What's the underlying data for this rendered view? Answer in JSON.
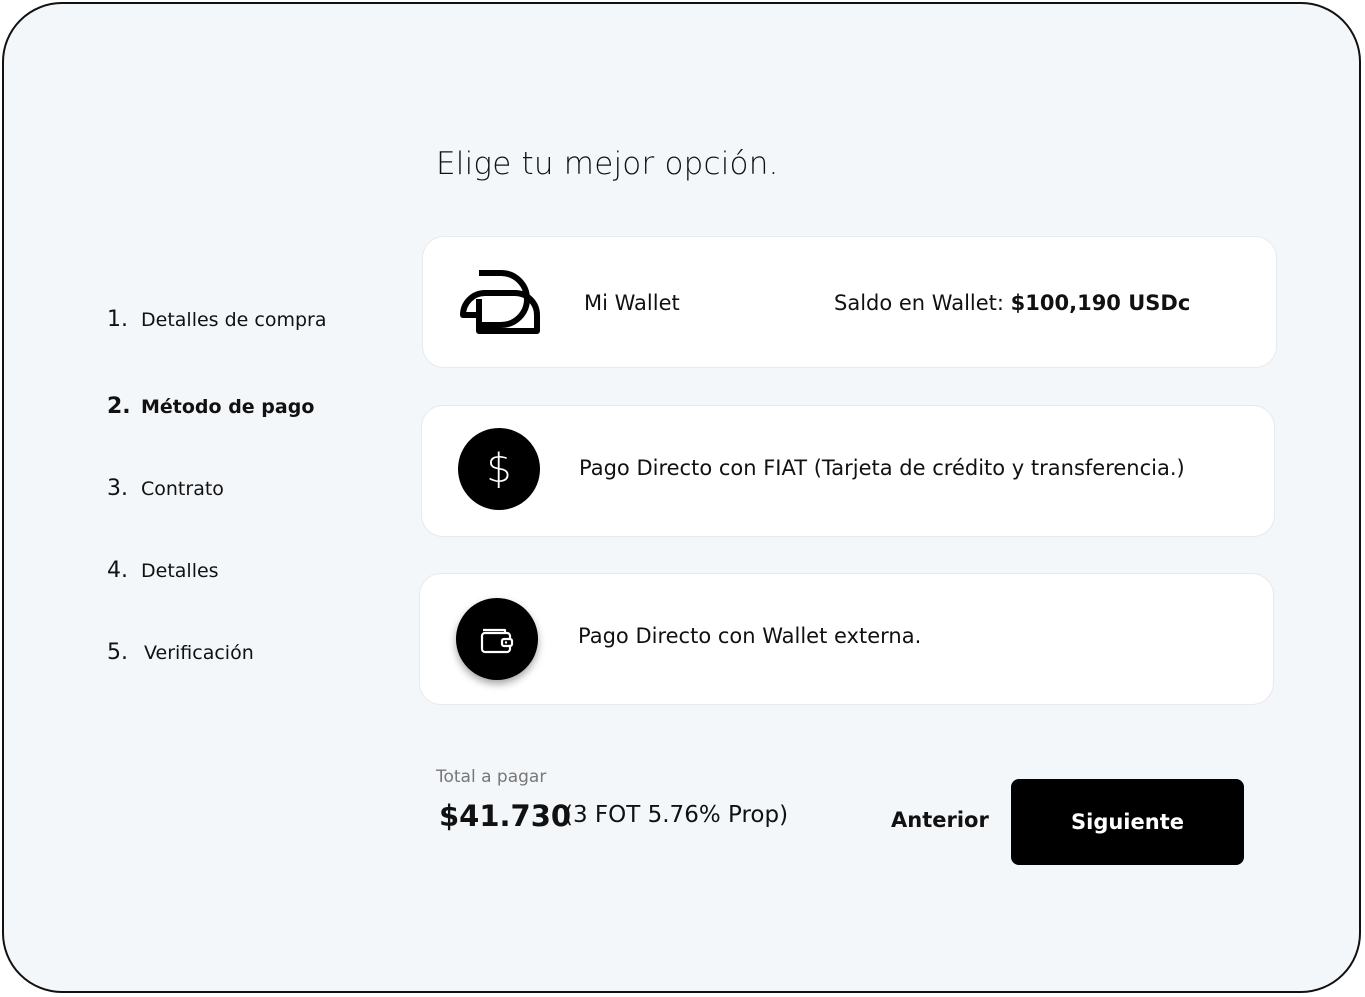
{
  "title": "Elige tu mejor opción.",
  "steps": [
    {
      "num": "1.",
      "label": "Detalles de compra"
    },
    {
      "num": "2.",
      "label": "Método de  pago"
    },
    {
      "num": "3.",
      "label": "Contrato"
    },
    {
      "num": "4.",
      "label": "Detalles"
    },
    {
      "num": "5.",
      "label": "Verificación"
    }
  ],
  "options": {
    "wallet": {
      "label": "Mi Wallet",
      "balance_prefix": "Saldo en Wallet: ",
      "balance_value": "$100,190 USDc",
      "icon": "wallet-logo-icon"
    },
    "fiat": {
      "label": "Pago Directo con FIAT (Tarjeta de crédito y transferencia.)",
      "icon": "dollar-icon",
      "icon_glyph": "$"
    },
    "external": {
      "label": "Pago Directo con Wallet externa.",
      "icon": "wallet-icon"
    }
  },
  "total": {
    "label": "Total a pagar",
    "amount": "$41.730",
    "detail": "(3 FOT  5.76% Prop)"
  },
  "buttons": {
    "prev": "Anterior",
    "next": "Siguiente"
  },
  "colors": {
    "background": "#f4f7fa",
    "card": "#ffffff",
    "primary": "#000000"
  }
}
